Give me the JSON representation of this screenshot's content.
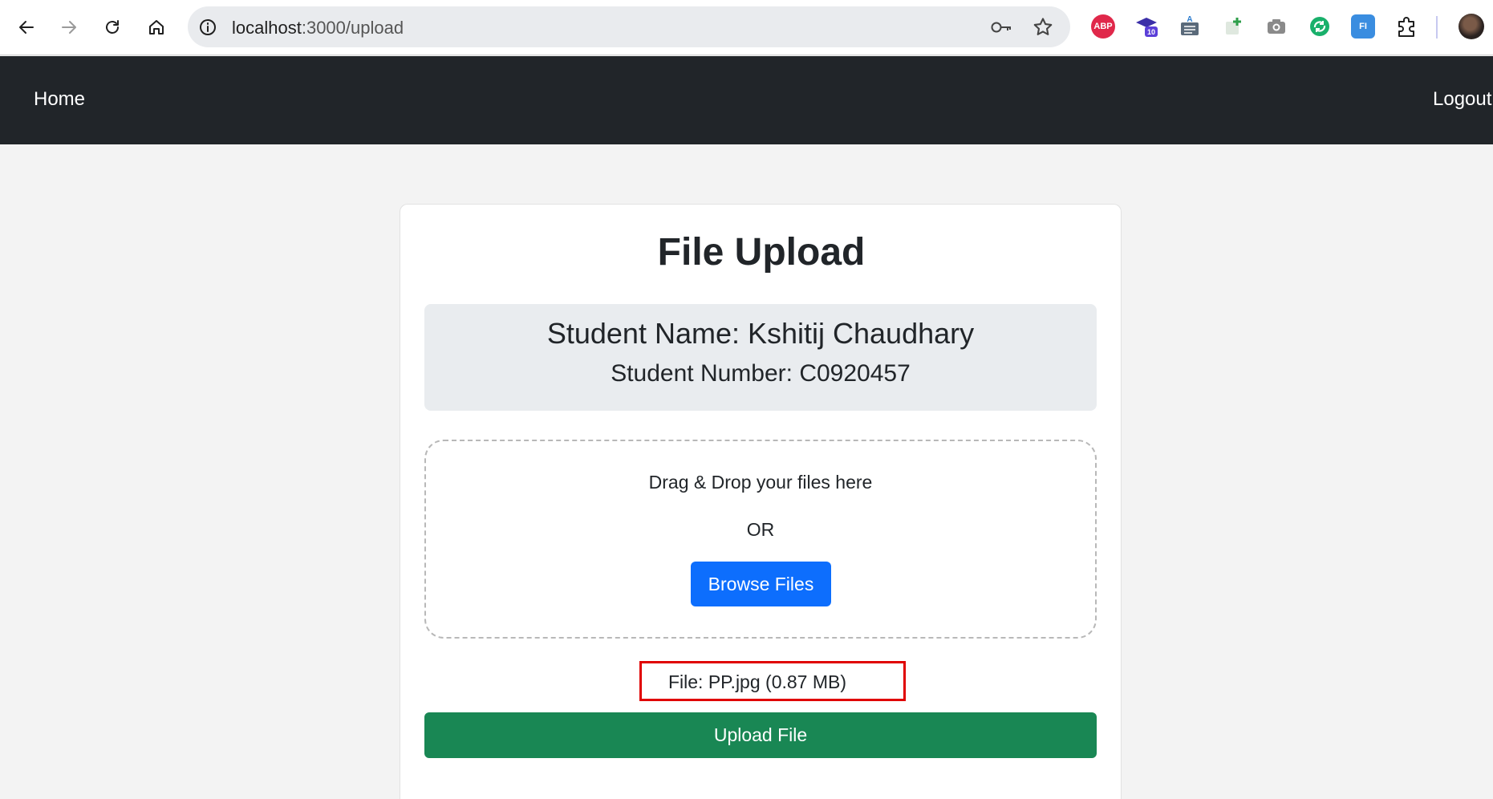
{
  "browser": {
    "url_host": "localhost",
    "url_path": ":3000/upload",
    "extensions": [
      {
        "name": "adblock-plus-icon",
        "label": "ABP",
        "color": "#e0284a"
      },
      {
        "name": "graduation-cap-icon",
        "label": "10",
        "color": "#3b2fa8"
      },
      {
        "name": "translate-icon",
        "label": "A",
        "color": "#2f7ecf"
      },
      {
        "name": "add-sheet-icon",
        "label": "+",
        "color": "#2e9e4a"
      },
      {
        "name": "camera-icon",
        "label": "",
        "color": "#8a8a8a"
      },
      {
        "name": "sync-icon",
        "label": "",
        "color": "#19b06b"
      },
      {
        "name": "fi-icon",
        "label": "FI",
        "color": "#3a8de0"
      }
    ]
  },
  "navbar": {
    "home_label": "Home",
    "logout_label": "Logout"
  },
  "card": {
    "title": "File Upload",
    "student_name": "Student Name: Kshitij Chaudhary",
    "student_number": "Student Number: C0920457",
    "dropzone_text": "Drag & Drop your files here",
    "or_text": "OR",
    "browse_label": "Browse Files",
    "file_info": "File: PP.jpg (0.87 MB)",
    "upload_label": "Upload File"
  },
  "colors": {
    "navbar_bg": "#212529",
    "browse_button": "#0d6efd",
    "upload_button": "#198754",
    "highlight_border": "#e00000"
  }
}
